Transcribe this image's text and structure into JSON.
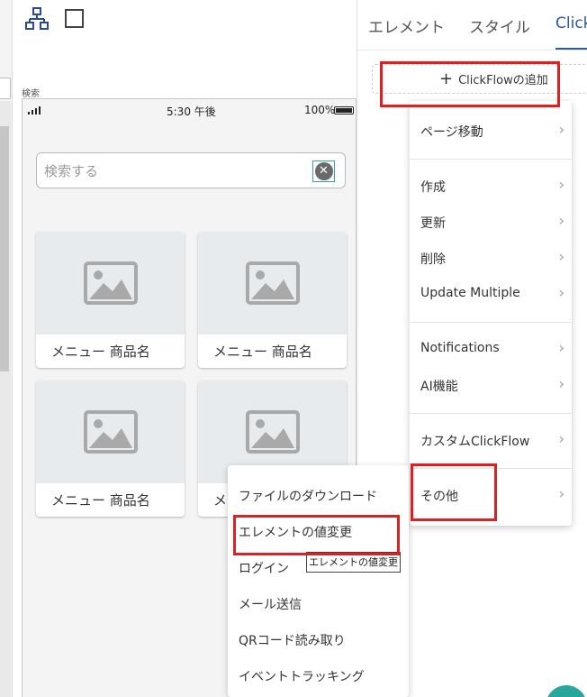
{
  "toolbar": {
    "icons": [
      "sitemap-icon",
      "square-icon"
    ]
  },
  "canvas": {
    "frame_label": "検索",
    "status_bar": {
      "time": "5:30 午後",
      "battery": "100%"
    },
    "search": {
      "placeholder": "検索する",
      "clear_symbol": "✕"
    },
    "cards": [
      {
        "label": "メニュー 商品名"
      },
      {
        "label": "メニュー 商品名"
      },
      {
        "label": "メニュー 商品名"
      },
      {
        "label": "メ"
      }
    ]
  },
  "right_panel": {
    "tabs": [
      {
        "label": "エレメント"
      },
      {
        "label": "スタイル"
      },
      {
        "label": "ClickF",
        "active": true
      }
    ],
    "add_clickflow": {
      "plus": "+",
      "label": "ClickFlowの追加"
    }
  },
  "clickflow_menu": {
    "items": [
      {
        "label": "ページ移動",
        "chevron": "›"
      },
      {
        "label": "作成",
        "chevron": "›"
      },
      {
        "label": "更新",
        "chevron": "›"
      },
      {
        "label": "削除",
        "chevron": "›"
      },
      {
        "label": "Update Multiple",
        "chevron": "›"
      },
      {
        "label": "Notifications",
        "chevron": "›"
      },
      {
        "label": "AI機能",
        "chevron": "›"
      },
      {
        "label": "カスタムClickFlow",
        "chevron": "›"
      },
      {
        "label": "その他",
        "chevron": "›"
      }
    ]
  },
  "other_submenu": {
    "items": [
      {
        "label": "ファイルのダウンロード"
      },
      {
        "label": "エレメントの値変更"
      },
      {
        "label": "ログイン"
      },
      {
        "label": "メール送信"
      },
      {
        "label": "QRコード読み取り"
      },
      {
        "label": "イベントトラッキング"
      }
    ],
    "tooltip": "エレメントの値変更"
  },
  "colors": {
    "accent": "#2b5aa8",
    "highlight": "#e02020",
    "fab": "#27a79c"
  }
}
